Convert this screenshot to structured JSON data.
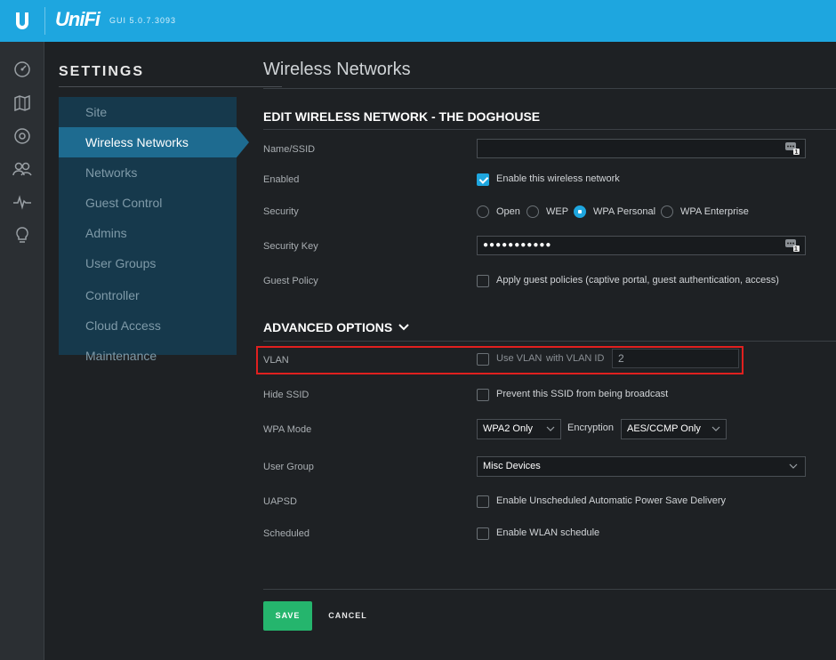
{
  "app": {
    "brand": "UniFi",
    "version": "GUI 5.0.7.3093"
  },
  "rail_icons": [
    "dashboard-icon",
    "map-icon",
    "devices-icon",
    "clients-icon",
    "statistics-icon",
    "insights-icon"
  ],
  "settings": {
    "title": "SETTINGS",
    "items": [
      {
        "label": "Site"
      },
      {
        "label": "Wireless Networks",
        "active": true
      },
      {
        "label": "Networks"
      },
      {
        "label": "Guest Control"
      },
      {
        "label": "Admins"
      },
      {
        "label": "User Groups"
      },
      {
        "label": "Controller"
      },
      {
        "label": "Cloud Access"
      },
      {
        "label": "Maintenance"
      }
    ]
  },
  "page": {
    "title": "Wireless Networks",
    "edit_heading": "EDIT WIRELESS NETWORK - THE DOGHOUSE",
    "advanced_heading": "ADVANCED OPTIONS"
  },
  "form": {
    "name_ssid": {
      "label": "Name/SSID",
      "value": ""
    },
    "enabled": {
      "label": "Enabled",
      "checkbox_label": "Enable this wireless network",
      "checked": true
    },
    "security": {
      "label": "Security",
      "options": [
        "Open",
        "WEP",
        "WPA Personal",
        "WPA Enterprise"
      ],
      "selected": "WPA Personal"
    },
    "security_key": {
      "label": "Security Key",
      "value": "●●●●●●●●●●●"
    },
    "guest_policy": {
      "label": "Guest Policy",
      "checkbox_label": "Apply guest policies (captive portal, guest authentication, access)",
      "checked": false
    },
    "vlan": {
      "label": "VLAN",
      "checkbox_label": "Use VLAN",
      "id_label": "with VLAN ID",
      "id_value": "2",
      "checked": false
    },
    "hide_ssid": {
      "label": "Hide SSID",
      "checkbox_label": "Prevent this SSID from being broadcast",
      "checked": false
    },
    "wpa_mode": {
      "label": "WPA Mode",
      "value": "WPA2 Only",
      "encryption_label": "Encryption",
      "encryption_value": "AES/CCMP Only"
    },
    "user_group": {
      "label": "User Group",
      "value": "Misc Devices"
    },
    "uapsd": {
      "label": "UAPSD",
      "checkbox_label": "Enable Unscheduled Automatic Power Save Delivery",
      "checked": false
    },
    "scheduled": {
      "label": "Scheduled",
      "checkbox_label": "Enable WLAN schedule",
      "checked": false
    }
  },
  "buttons": {
    "save": "SAVE",
    "cancel": "CANCEL"
  },
  "colors": {
    "accent": "#1ea6df",
    "save": "#25b56d",
    "highlight": "#e0201f"
  }
}
